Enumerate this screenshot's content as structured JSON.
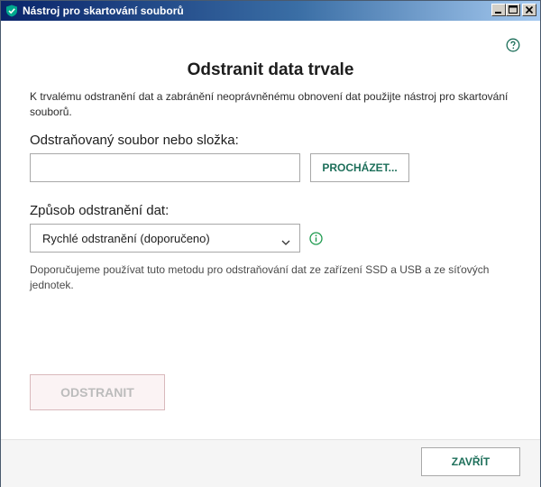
{
  "window": {
    "title": "Nástroj pro skartování souborů"
  },
  "main": {
    "heading": "Odstranit data trvale",
    "description": "K trvalému odstranění dat a zabránění neoprávněnému obnovení dat použijte nástroj pro skartování souborů.",
    "file_label": "Odstraňovaný soubor nebo složka:",
    "file_input_value": "",
    "browse_label": "PROCHÁZET...",
    "method_label": "Způsob odstranění dat:",
    "method_selected": "Rychlé odstranění (doporučeno)",
    "hint": "Doporučujeme používat tuto metodu pro odstraňování dat ze zařízení SSD a USB a ze síťových jednotek.",
    "delete_label": "ODSTRANIT"
  },
  "footer": {
    "close_label": "ZAVŘÍT"
  },
  "colors": {
    "accent_green": "#1d6f5a",
    "titlebar_dark": "#0a246a",
    "titlebar_light": "#a6caf0"
  },
  "icons": {
    "app": "kaspersky-shield-icon",
    "help": "help-icon",
    "info": "info-icon",
    "dropdown": "chevron-down-icon",
    "minimize": "minimize-icon",
    "maximize": "maximize-icon",
    "close": "close-icon"
  }
}
